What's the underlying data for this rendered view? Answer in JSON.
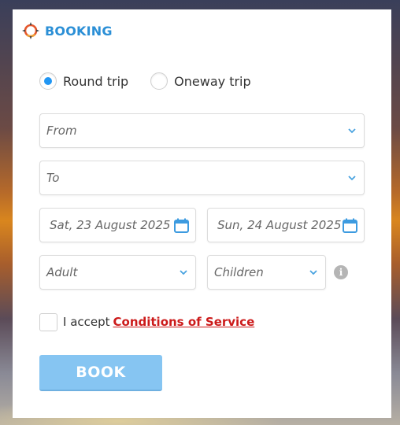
{
  "brand": {
    "title": "BOOKING",
    "logo_icon": "compass-icon",
    "color": "#2b8fd6"
  },
  "trip_type": {
    "options": [
      {
        "label": "Round trip",
        "checked": true
      },
      {
        "label": "Oneway trip",
        "checked": false
      }
    ],
    "accent": "#2196f3"
  },
  "route": {
    "from_placeholder": "From",
    "to_placeholder": "To"
  },
  "dates": {
    "departure": "Sat, 23 August 2025",
    "return": "Sun, 24 August 2025",
    "icon": "calendar-icon"
  },
  "passengers": {
    "adult_placeholder": "Adult",
    "children_placeholder": "Children",
    "info_icon": "info-icon"
  },
  "terms": {
    "prefix": "I accept",
    "link_text": "Conditions of Service",
    "link_color": "#cc1a1a"
  },
  "submit": {
    "label": "BOOK",
    "color": "#86c5f2"
  }
}
